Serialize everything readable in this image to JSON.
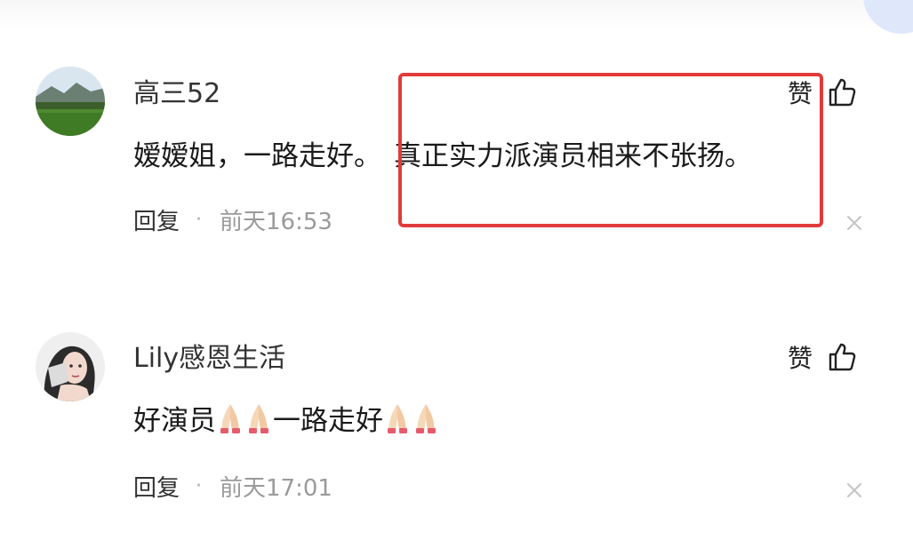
{
  "comments": [
    {
      "username": "高三52",
      "like_label": "赞",
      "content_plain": "嫒嫒姐，一路走好。",
      "content_highlight": "真正实力派演员相来不张扬。",
      "reply_label": "回复",
      "separator": "·",
      "timestamp": "前天16:53",
      "avatar_icon": "landscape-avatar-icon",
      "like_icon": "thumbs-up-icon",
      "close_icon": "close-icon"
    },
    {
      "username": "Lily感恩生活",
      "like_label": "赞",
      "content_part1": "好演员",
      "content_part2": "一路走好",
      "emoji": "folded-hands-icon",
      "reply_label": "回复",
      "separator": "·",
      "timestamp": "前天17:01",
      "avatar_icon": "portrait-avatar-icon",
      "like_icon": "thumbs-up-icon",
      "close_icon": "close-icon"
    }
  ],
  "colors": {
    "highlight_border": "#e23a3a",
    "text_primary": "#1a1a1a",
    "text_secondary": "#9a9a9a"
  }
}
